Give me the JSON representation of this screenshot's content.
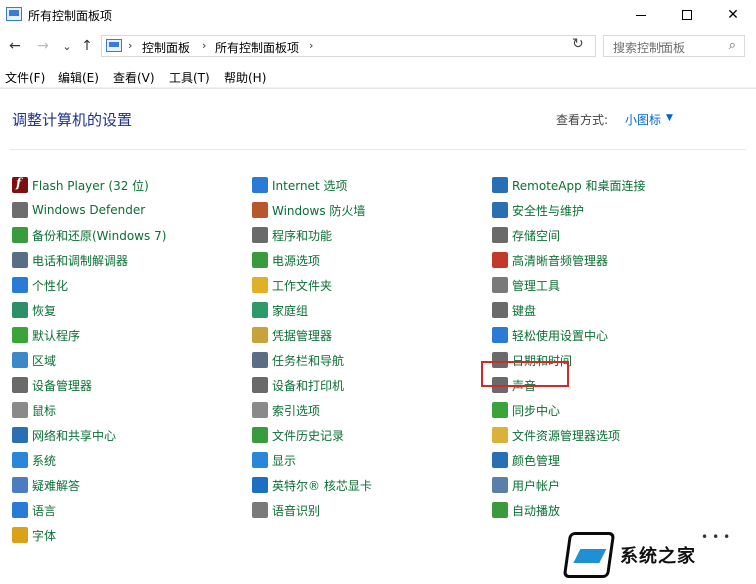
{
  "window": {
    "title": "所有控制面板项",
    "minimize": "—",
    "maximize": "□",
    "close": "✕"
  },
  "nav": {
    "back": "←",
    "forward": "→",
    "recent": "⌄",
    "up": "↑"
  },
  "address": {
    "crumbs": [
      "控制面板",
      "所有控制面板项"
    ],
    "sep": "›",
    "dropdown": "⌄",
    "refresh": "↻"
  },
  "search": {
    "placeholder": "搜索控制面板",
    "icon": "⌕"
  },
  "menu": [
    "文件(F)",
    "编辑(E)",
    "查看(V)",
    "工具(T)",
    "帮助(H)"
  ],
  "content": {
    "heading": "调整计算机的设置",
    "view_by_label": "查看方式:",
    "view_by_value": "小图标",
    "view_by_arrow": "▼"
  },
  "items": {
    "col1": [
      {
        "label": "Flash Player (32 位)",
        "icon": "flash-icon",
        "color": "#7a1010"
      },
      {
        "label": "Windows Defender",
        "icon": "defender-icon",
        "color": "#6d6d6d"
      },
      {
        "label": "备份和还原(Windows 7)",
        "icon": "backup-icon",
        "color": "#3b9a3b"
      },
      {
        "label": "电话和调制解调器",
        "icon": "phone-modem-icon",
        "color": "#5a6d85"
      },
      {
        "label": "个性化",
        "icon": "personalization-icon",
        "color": "#2a7bd6"
      },
      {
        "label": "恢复",
        "icon": "recovery-icon",
        "color": "#2d8f6a"
      },
      {
        "label": "默认程序",
        "icon": "default-programs-icon",
        "color": "#3aa33a"
      },
      {
        "label": "区域",
        "icon": "region-icon",
        "color": "#3d88c7"
      },
      {
        "label": "设备管理器",
        "icon": "device-manager-icon",
        "color": "#6a6a6a"
      },
      {
        "label": "鼠标",
        "icon": "mouse-icon",
        "color": "#8a8a8a"
      },
      {
        "label": "网络和共享中心",
        "icon": "network-icon",
        "color": "#2b6fb3"
      },
      {
        "label": "系统",
        "icon": "system-icon",
        "color": "#2a86d6"
      },
      {
        "label": "疑难解答",
        "icon": "troubleshoot-icon",
        "color": "#4d7dbf"
      },
      {
        "label": "语言",
        "icon": "language-icon",
        "color": "#2a7bd6"
      },
      {
        "label": "字体",
        "icon": "fonts-icon",
        "color": "#d9a21a"
      }
    ],
    "col2": [
      {
        "label": "Internet 选项",
        "icon": "internet-options-icon",
        "color": "#2a7bd6"
      },
      {
        "label": "Windows 防火墙",
        "icon": "firewall-icon",
        "color": "#b8562c"
      },
      {
        "label": "程序和功能",
        "icon": "programs-icon",
        "color": "#6a6a6a"
      },
      {
        "label": "电源选项",
        "icon": "power-icon",
        "color": "#3b9a3b"
      },
      {
        "label": "工作文件夹",
        "icon": "work-folders-icon",
        "color": "#e0b028"
      },
      {
        "label": "家庭组",
        "icon": "homegroup-icon",
        "color": "#2e9a6a"
      },
      {
        "label": "凭据管理器",
        "icon": "credential-icon",
        "color": "#c8a23a"
      },
      {
        "label": "任务栏和导航",
        "icon": "taskbar-icon",
        "color": "#5a6d85"
      },
      {
        "label": "设备和打印机",
        "icon": "printer-icon",
        "color": "#6a6a6a"
      },
      {
        "label": "索引选项",
        "icon": "indexing-icon",
        "color": "#8a8a8a"
      },
      {
        "label": "文件历史记录",
        "icon": "file-history-icon",
        "color": "#3b9a3b"
      },
      {
        "label": "显示",
        "icon": "display-icon",
        "color": "#2a86d6"
      },
      {
        "label": "英特尔® 核芯显卡",
        "icon": "intel-graphics-icon",
        "color": "#1f6fc0"
      },
      {
        "label": "语音识别",
        "icon": "speech-icon",
        "color": "#7a7a7a"
      }
    ],
    "col3": [
      {
        "label": "RemoteApp 和桌面连接",
        "icon": "remoteapp-icon",
        "color": "#2a6fb3"
      },
      {
        "label": "安全性与维护",
        "icon": "flag-icon",
        "color": "#2a6fb3"
      },
      {
        "label": "存储空间",
        "icon": "storage-icon",
        "color": "#6a6a6a"
      },
      {
        "label": "高清晰音频管理器",
        "icon": "audio-manager-icon",
        "color": "#c23a2a"
      },
      {
        "label": "管理工具",
        "icon": "admin-tools-icon",
        "color": "#7a7a7a"
      },
      {
        "label": "键盘",
        "icon": "keyboard-icon",
        "color": "#6a6a6a"
      },
      {
        "label": "轻松使用设置中心",
        "icon": "ease-of-access-icon",
        "color": "#2a7bd6"
      },
      {
        "label": "日期和时间",
        "icon": "date-time-icon",
        "color": "#6a6a6a"
      },
      {
        "label": "声音",
        "icon": "sound-icon",
        "color": "#6a6a6a"
      },
      {
        "label": "同步中心",
        "icon": "sync-icon",
        "color": "#3aa33a"
      },
      {
        "label": "文件资源管理器选项",
        "icon": "explorer-options-icon",
        "color": "#d9b23a"
      },
      {
        "label": "颜色管理",
        "icon": "color-management-icon",
        "color": "#2a6fb3"
      },
      {
        "label": "用户帐户",
        "icon": "user-accounts-icon",
        "color": "#5a7fa8"
      },
      {
        "label": "自动播放",
        "icon": "autoplay-icon",
        "color": "#3b9a3b"
      }
    ]
  },
  "watermark": {
    "text": "系统之家",
    "dots": "•••"
  }
}
